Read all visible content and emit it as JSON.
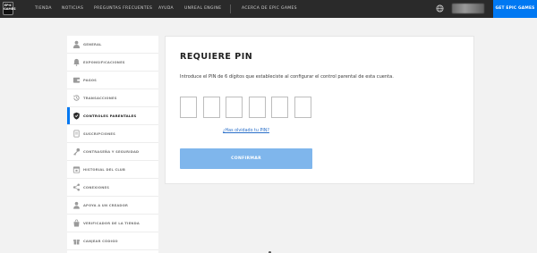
{
  "header": {
    "logo_line1": "EPIC",
    "logo_line2": "GAMES",
    "nav": [
      "TIENDA",
      "NOTICIAS",
      "PREGUNTAS FRECUENTES",
      "AYUDA",
      "UNREAL ENGINE"
    ],
    "about": "ACERCA DE EPIC GAMES",
    "get_button": "GET EPIC GAMES",
    "accent_color": "#0078f2"
  },
  "sidebar": {
    "items": [
      {
        "label": "GENERAL",
        "icon": "person-icon"
      },
      {
        "label": "EXPONSIFICACIONES",
        "icon": "bell-icon"
      },
      {
        "label": "PAGOS",
        "icon": "wallet-icon"
      },
      {
        "label": "TRANSACCIONES",
        "icon": "history-icon"
      },
      {
        "label": "CONTROLES PARENTALES",
        "icon": "shield-icon",
        "active": true
      },
      {
        "label": "SUSCRIPCIONES",
        "icon": "document-icon"
      },
      {
        "label": "CONTRASEÑA Y SEGURIDAD",
        "icon": "key-icon"
      },
      {
        "label": "HISTORIAL DEL CLUB",
        "icon": "calendar-icon"
      },
      {
        "label": "CONEXIONES",
        "icon": "share-icon"
      },
      {
        "label": "APOYA A UN CREADOR",
        "icon": "creator-icon"
      },
      {
        "label": "VERIFICADOR DE LA TIENDA",
        "icon": "bag-icon"
      },
      {
        "label": "CANJEAR CÓDIGO",
        "icon": "gift-icon"
      }
    ]
  },
  "card": {
    "title": "REQUIERE PIN",
    "description": "Introduce el PIN de 6 dígitos que estableciste al configurar el control parental de esta cuenta.",
    "pin_digits": [
      "",
      "",
      "",
      "",
      "",
      ""
    ],
    "forgot_link": "¿Has olvidado tu PIN?",
    "confirm_button": "CONFIRMAR"
  }
}
